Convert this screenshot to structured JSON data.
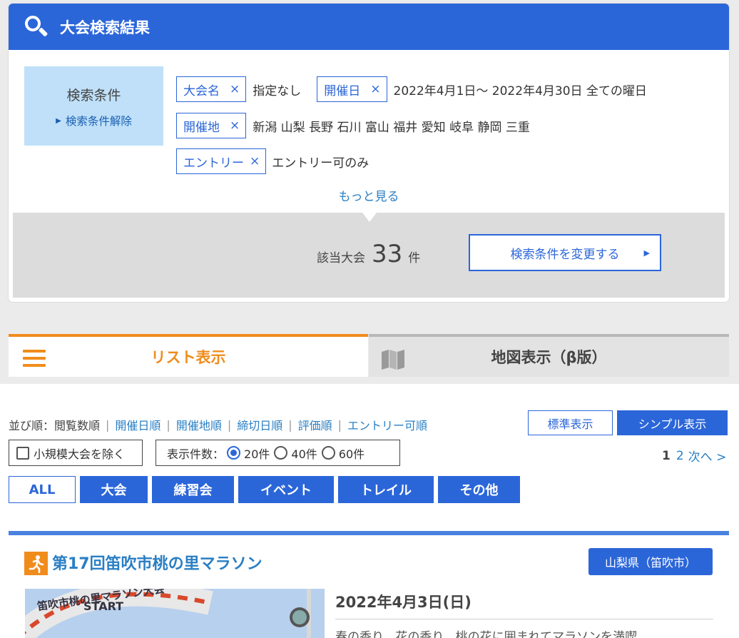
{
  "header": {
    "title": "大会検索結果"
  },
  "conditions": {
    "box_title": "検索条件",
    "clear_link": "検索条件解除",
    "rows": [
      [
        {
          "chip": "大会名",
          "value": "指定なし"
        },
        {
          "chip": "開催日",
          "value": "2022年4月1日～ 2022年4月30日  全ての曜日"
        }
      ],
      [
        {
          "chip": "開催地",
          "value": "新潟 山梨 長野 石川 富山 福井 愛知 岐阜 静岡 三重"
        }
      ],
      [
        {
          "chip": "エントリー",
          "value": "エントリー可のみ"
        }
      ]
    ],
    "remove_glyph": "×",
    "more_link": "もっと見る"
  },
  "result": {
    "label": "該当大会",
    "count": "33",
    "unit": "件",
    "change_button": "検索条件を変更する"
  },
  "tabs": {
    "list": "リスト表示",
    "map": "地図表示（β版）"
  },
  "sort": {
    "label": "並び順：閲覧数順",
    "options": [
      "開催日順",
      "開催地順",
      "締切日順",
      "評価順",
      "エントリー可順"
    ]
  },
  "view": {
    "standard": "標準表示",
    "simple": "シンプル表示"
  },
  "filters": {
    "exclude_small": "小規模大会を除く",
    "per_page_label": "表示件数：",
    "per_page_options": [
      "20件",
      "40件",
      "60件"
    ],
    "per_page_selected": "20件"
  },
  "pager": {
    "current": "1",
    "next_page": "2",
    "next_label": "次へ >"
  },
  "categories": [
    "ALL",
    "大会",
    "練習会",
    "イベント",
    "トレイル",
    "その他"
  ],
  "event": {
    "title": "第17回笛吹市桃の里マラソン",
    "prefecture": "山梨県（笛吹市）",
    "date": "2022年4月3日(日)",
    "description": "春の香り、花の香り、桃の花に囲まれてマラソンを満喫",
    "photo_banner_text": "笛吹市桃の里マラソン大会",
    "photo_start_text": "START"
  },
  "colors": {
    "primary": "#2b66d9",
    "accent": "#f08c1c",
    "link": "#2a7fc4"
  }
}
